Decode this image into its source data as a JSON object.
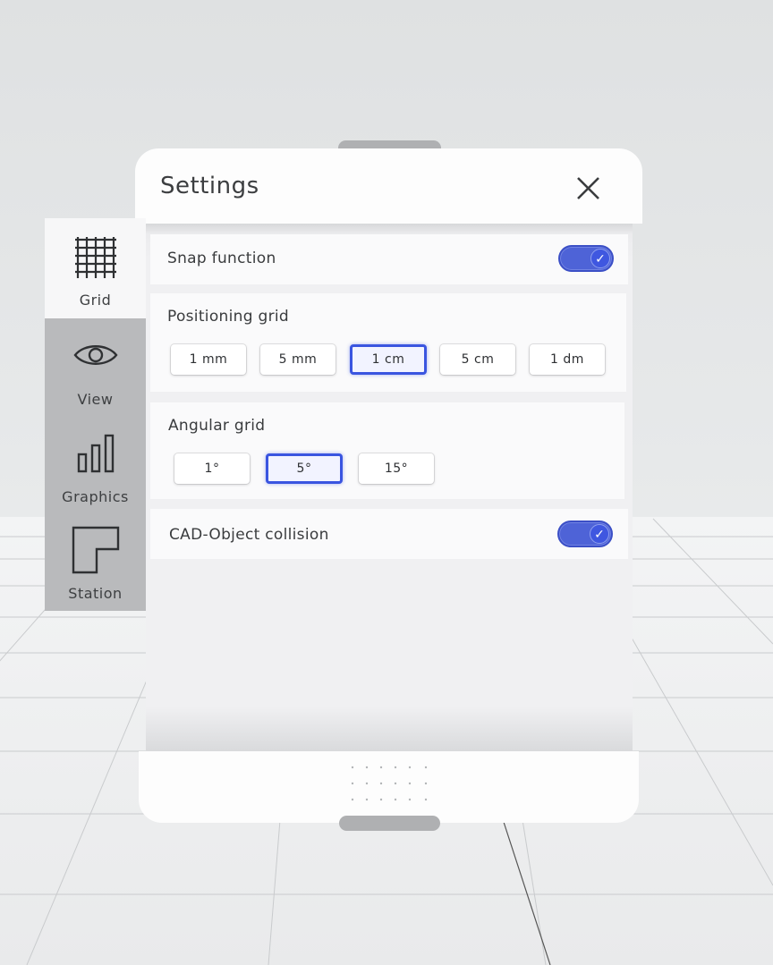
{
  "colors": {
    "accent": "#3a55e0",
    "toggle_on": "#4e63d7",
    "panel": "#fdfdfd",
    "sidebar": "#b9babc"
  },
  "window": {
    "title": "Settings",
    "close_icon": "close-icon"
  },
  "sidebar": {
    "items": [
      {
        "label": "Grid",
        "icon": "grid-icon",
        "active": true
      },
      {
        "label": "View",
        "icon": "eye-icon",
        "active": false
      },
      {
        "label": "Graphics",
        "icon": "bar-chart-icon",
        "active": false
      },
      {
        "label": "Station",
        "icon": "station-outline-icon",
        "active": false
      }
    ]
  },
  "settings": {
    "snap": {
      "label": "Snap function",
      "on": true
    },
    "positioning": {
      "label": "Positioning grid",
      "options": [
        "1 mm",
        "5 mm",
        "1 cm",
        "5 cm",
        "1 dm"
      ],
      "selected": "1 cm"
    },
    "angular": {
      "label": "Angular grid",
      "options": [
        "1°",
        "5°",
        "15°"
      ],
      "selected": "5°"
    },
    "collision": {
      "label": "CAD-Object collision",
      "on": true
    }
  }
}
